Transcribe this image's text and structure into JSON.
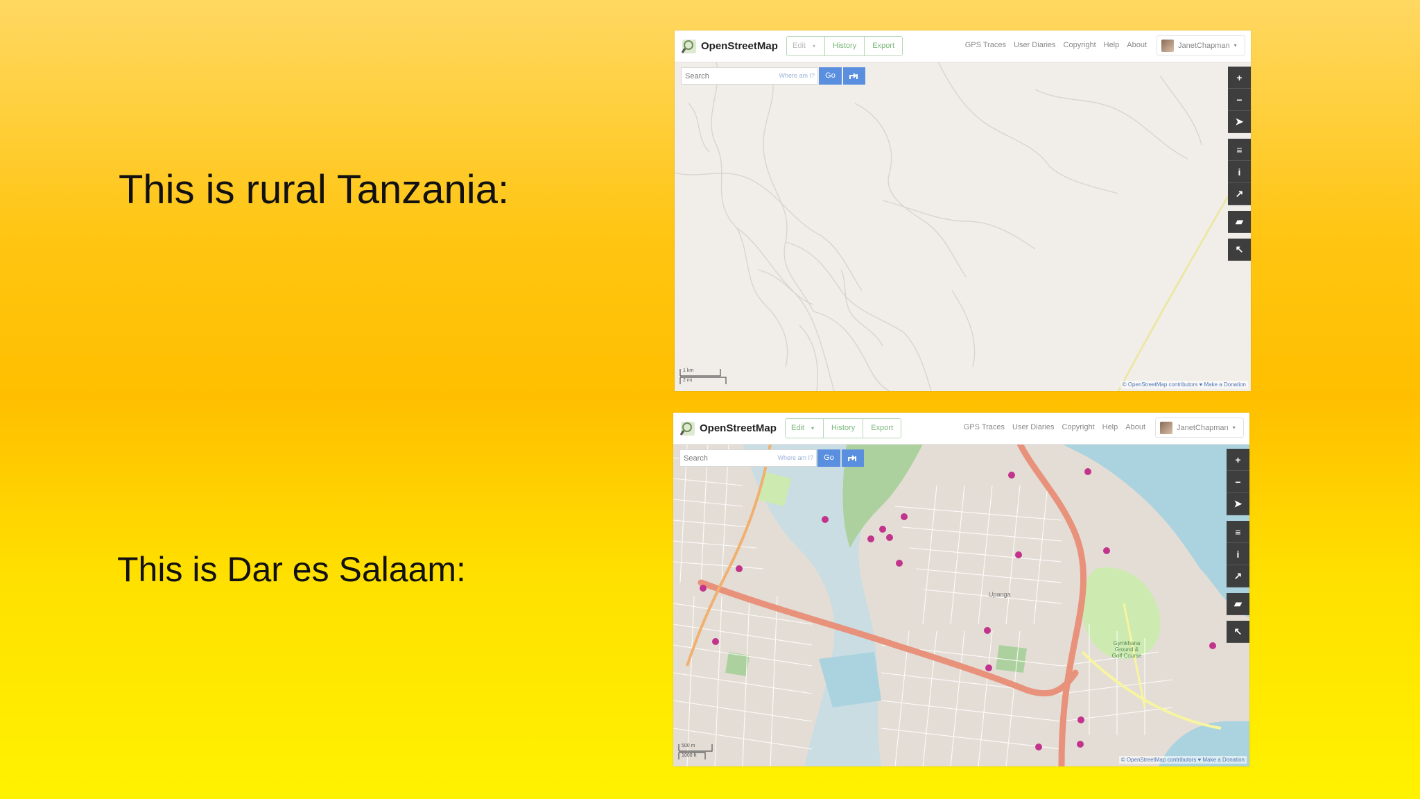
{
  "slide": {
    "caption_rural": "This is rural Tanzania:",
    "caption_city": "This is Dar es Salaam:"
  },
  "osm_windows": [
    {
      "brand": "OpenStreetMap",
      "tabs": [
        "Edit",
        "History",
        "Export"
      ],
      "nav_links": [
        "GPS Traces",
        "User Diaries",
        "Copyright",
        "Help",
        "About"
      ],
      "user_name": "JanetChapman",
      "search_placeholder": "Search",
      "where_label": "Where am I?",
      "go_label": "Go",
      "scale_top": "1 km",
      "scale_bottom": "2 mi",
      "attribution": "© OpenStreetMap contributors ♥ Make a Donation",
      "map_content": "rural"
    },
    {
      "brand": "OpenStreetMap",
      "tabs": [
        "Edit",
        "History",
        "Export"
      ],
      "nav_links": [
        "GPS Traces",
        "User Diaries",
        "Copyright",
        "Help",
        "About"
      ],
      "user_name": "JanetChapman",
      "search_placeholder": "Search",
      "where_label": "Where am I?",
      "go_label": "Go",
      "scale_top": "500 m",
      "scale_bottom": "1000 ft",
      "attribution": "© OpenStreetMap contributors ♥ Make a Donation",
      "map_content": "city",
      "map_labels": [
        "Gymkhana Ground & Golf Course",
        "Upanga"
      ]
    }
  ],
  "colors": {
    "accent_button": "#5a8fe0",
    "tab_text": "#7ab87a",
    "control_bg": "#3e3e3e",
    "road_major": "#e8927c",
    "water": "#aad3df",
    "park": "#add19e",
    "poi": "#c2338c"
  },
  "map_controls": [
    "zoom-in-icon",
    "zoom-out-icon",
    "locate-icon",
    "layers-icon",
    "info-icon",
    "share-icon",
    "note-icon",
    "query-icon"
  ]
}
